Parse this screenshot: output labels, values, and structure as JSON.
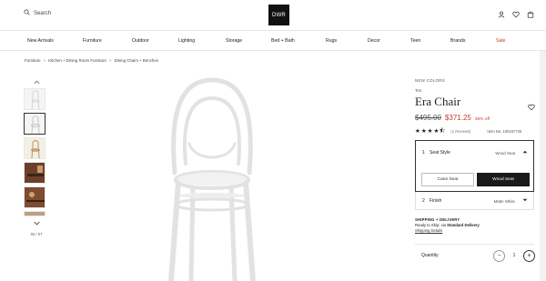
{
  "header": {
    "search_label": "Search",
    "logo_text": "DWR",
    "icons": [
      "user-icon",
      "heart-icon",
      "bag-icon"
    ]
  },
  "nav": {
    "items": [
      "New Arrivals",
      "Furniture",
      "Outdoor",
      "Lighting",
      "Storage",
      "Bed + Bath",
      "Rugs",
      "Decor",
      "Teen",
      "Brands",
      "Sale"
    ],
    "sale_color": "#c9362c"
  },
  "breadcrumb": [
    "Furniture",
    "Kitchen + Dining Room Furniture",
    "Dining Chairs + Benches"
  ],
  "gallery": {
    "thumb_count_text": "02 / 07",
    "selected_index": 2
  },
  "product": {
    "new_colors": "NEW COLORS",
    "brand": "Ton",
    "title": "Era Chair",
    "old_price": "$495.00",
    "new_price": "$371.25",
    "discount": "25% off",
    "rating": 4.5,
    "reviews": "(1 Reviews)",
    "item_no": "Item No. 100157725",
    "seat_style": {
      "number": "1",
      "label": "Seat Style",
      "value": "Wood Seat",
      "options": [
        "Cane Seat",
        "Wood Seat"
      ],
      "selected": "Wood Seat"
    },
    "finish": {
      "number": "2",
      "label": "Finish",
      "value": "Matte White"
    },
    "shipping": {
      "heading": "SHIPPING + DELIVERY",
      "ready_text": "Ready to Ship: via",
      "method": "Standard Delivery",
      "details_link": "Shipping Details"
    },
    "quantity": {
      "label": "Quantity",
      "value": "1",
      "minus": "−",
      "plus": "+"
    }
  },
  "colors": {
    "accent_red": "#c9362c",
    "dark": "#1a1a1a"
  }
}
